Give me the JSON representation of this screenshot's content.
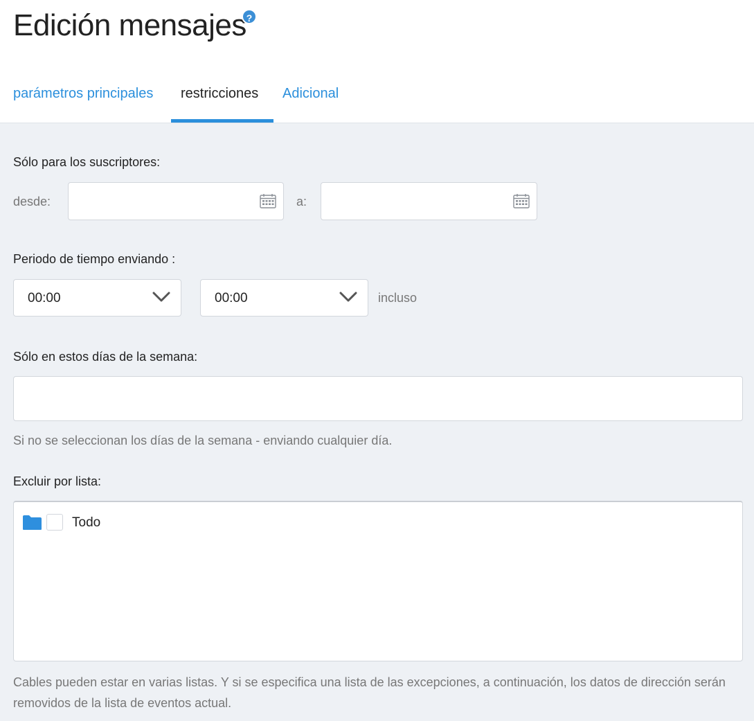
{
  "page": {
    "title": "Edición mensajes",
    "help_icon": "?"
  },
  "tabs": [
    {
      "label": "parámetros principales",
      "active": false
    },
    {
      "label": "restricciones",
      "active": true
    },
    {
      "label": "Adicional",
      "active": false
    }
  ],
  "subscribers": {
    "label": "Sólo para los suscriptores:",
    "from_label": "desde:",
    "from_value": "",
    "to_label": "a:",
    "to_value": ""
  },
  "period": {
    "label": "Periodo de tiempo enviando :",
    "start": "00:00",
    "end": "00:00",
    "suffix": "incluso"
  },
  "weekdays": {
    "label": "Sólo en estos días de la semana:",
    "value": "",
    "hint": "Si no se seleccionan los días de la semana - enviando cualquier día."
  },
  "exclude": {
    "label": "Excluir por lista:",
    "tree_items": [
      {
        "label": "Todo",
        "checked": false,
        "icon": "folder-icon"
      }
    ],
    "footnote": "Cables pueden estar en varias listas. Y si se especifica una lista de las excepciones, a continuación, los datos de dirección serán removidos de la lista de eventos actual."
  },
  "colors": {
    "accent": "#2b8fdc",
    "background": "#eef1f5"
  }
}
